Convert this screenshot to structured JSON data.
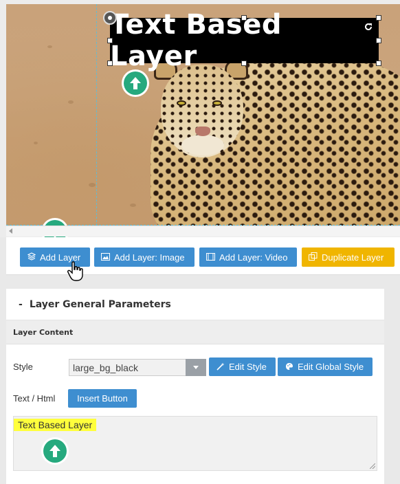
{
  "canvas": {
    "layer_text": "Text Based Layer"
  },
  "toolbar": {
    "add_layer": "Add Layer",
    "add_layer_image": "Add Layer: Image",
    "add_layer_video": "Add Layer: Video",
    "duplicate_layer": "Duplicate Layer"
  },
  "panel": {
    "collapse_symbol": "-",
    "title": "Layer General Parameters",
    "section": "Layer Content",
    "style_label": "Style",
    "style_value": "large_bg_black",
    "edit_style": "Edit Style",
    "edit_global_style": "Edit Global Style",
    "text_html_label": "Text / Html",
    "insert_button": "Insert Button",
    "textarea_value": "Text Based Layer"
  },
  "icons": {
    "add_layer": "layers-icon",
    "add_layer_image": "image-icon",
    "add_layer_video": "film-icon",
    "duplicate_layer": "duplicate-icon",
    "edit_style": "magic-wand-icon",
    "edit_global_style": "palette-icon",
    "badge": "arrow-up-icon"
  },
  "colors": {
    "primary_button": "#3e8ed0",
    "duplicate_button": "#f0b500",
    "badge": "#26a97e",
    "highlight": "#ffff3c",
    "layer_bg": "#000000"
  }
}
